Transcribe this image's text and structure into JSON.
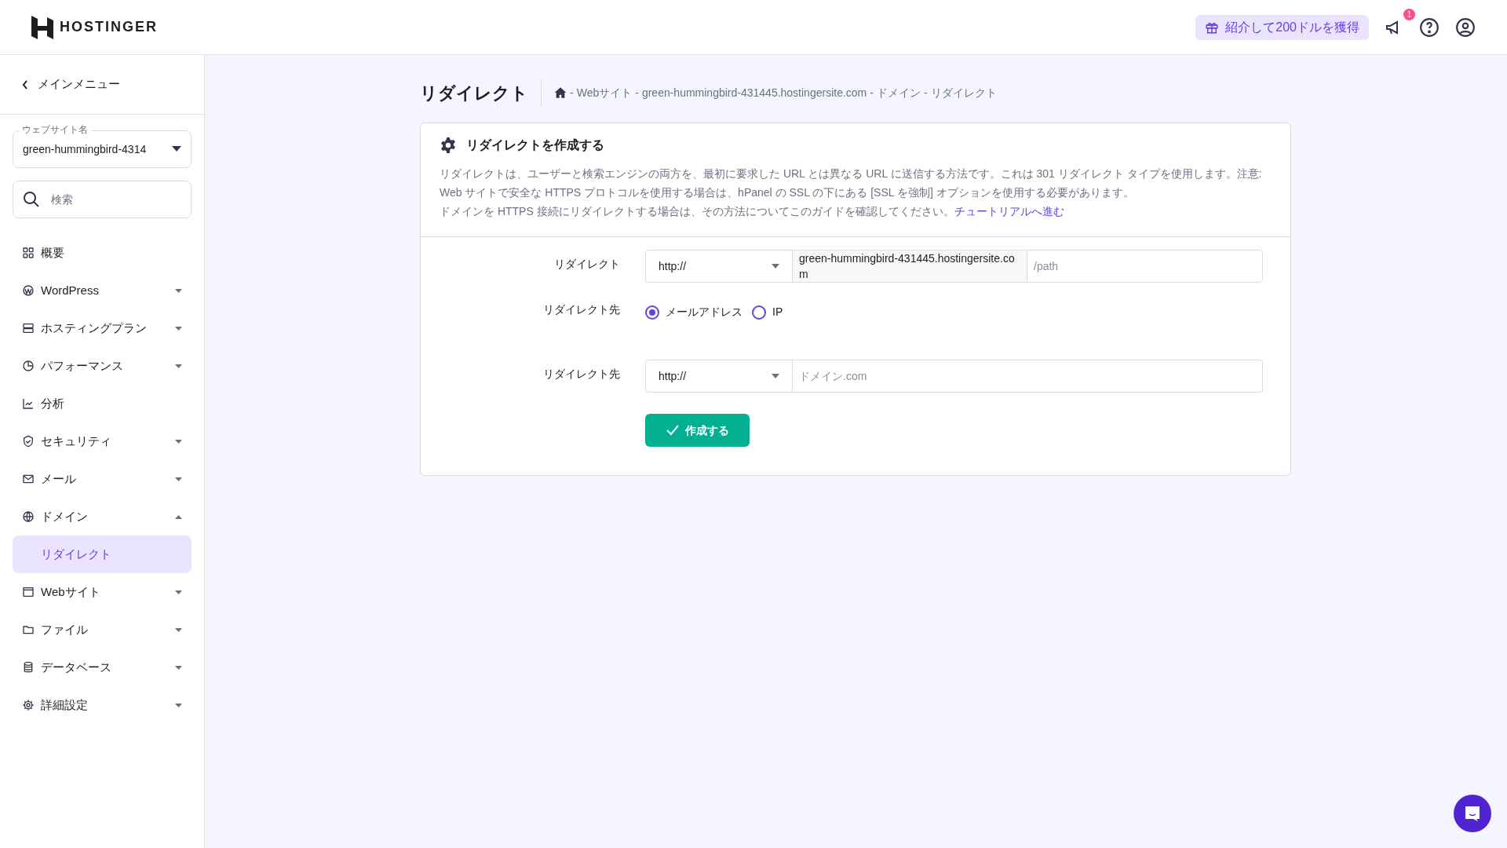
{
  "header": {
    "logo": "HOSTINGER",
    "referral": "紹介して200ドルを獲得",
    "notification_badge": "1"
  },
  "sidebar": {
    "back": "メインメニュー",
    "website_select": {
      "label": "ウェブサイト名",
      "value": "green-hummingbird-4314"
    },
    "search": {
      "placeholder": "検索"
    },
    "items": [
      {
        "label": "概要",
        "kind": "link"
      },
      {
        "label": "WordPress",
        "kind": "group",
        "expanded": false
      },
      {
        "label": "ホスティングプラン",
        "kind": "group",
        "expanded": false
      },
      {
        "label": "パフォーマンス",
        "kind": "group",
        "expanded": false
      },
      {
        "label": "分析",
        "kind": "link"
      },
      {
        "label": "セキュリティ",
        "kind": "group",
        "expanded": false
      },
      {
        "label": "メール",
        "kind": "group",
        "expanded": false
      },
      {
        "label": "ドメイン",
        "kind": "group",
        "expanded": true,
        "children": [
          {
            "label": "リダイレクト",
            "selected": true
          }
        ]
      },
      {
        "label": "Webサイト",
        "kind": "group",
        "expanded": false
      },
      {
        "label": "ファイル",
        "kind": "group",
        "expanded": false
      },
      {
        "label": "データベース",
        "kind": "group",
        "expanded": false
      },
      {
        "label": "詳細設定",
        "kind": "group",
        "expanded": false
      }
    ]
  },
  "page": {
    "title": "リダイレクト",
    "breadcrumb": [
      {
        "separator": "-",
        "label": "Webサイト"
      },
      {
        "separator": "-",
        "label": "green-hummingbird-431445.hostingersite.com"
      },
      {
        "separator": "-",
        "label": "ドメイン"
      },
      {
        "separator": "-",
        "label": "リダイレクト"
      }
    ]
  },
  "card": {
    "title": "リダイレクトを作成する",
    "description": [
      "リダイレクトは、ユーザーと検索エンジンの両方を、最初に要求した URL とは異なる URL に送信する方法です。これは 301 リダイレクト タイプを使用します。注意:",
      "Web サイトで安全な HTTPS プロトコルを使用する場合は、hPanel の SSL の下にある [SSL を強制] オプションを使用する必要があります。",
      "ドメインを HTTPS 接続にリダイレクトする場合は、その方法についてこのガイドを確認してください。"
    ],
    "tutorial_link": "チュートリアルへ進む",
    "form": {
      "redirect_label": "リダイレクト",
      "redirect_protocol": "http://",
      "redirect_domain": "green-hummingbird-431445.hostingersite.com",
      "path_placeholder": "/path",
      "target_type_label": "リダイレクト先",
      "target_types": [
        {
          "label": "メールアドレス",
          "selected": true
        },
        {
          "label": "IP",
          "selected": false
        }
      ],
      "target_label": "リダイレクト先",
      "target_protocol": "http://",
      "target_placeholder": "ドメイン.com",
      "submit": "作成する"
    }
  }
}
